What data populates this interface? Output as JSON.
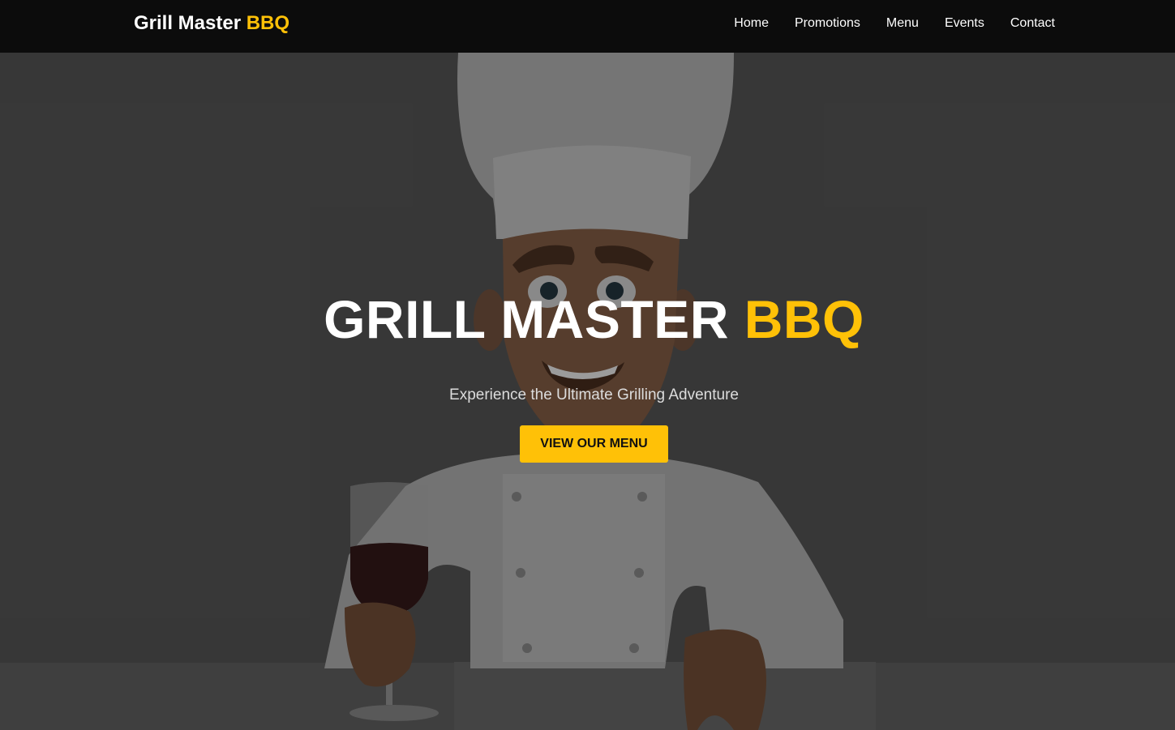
{
  "brand": {
    "name": "Grill Master",
    "accent": "BBQ"
  },
  "nav": {
    "items": [
      "Home",
      "Promotions",
      "Menu",
      "Events",
      "Contact"
    ]
  },
  "hero": {
    "title": "GRILL MASTER",
    "title_accent": "BBQ",
    "subtitle": "Experience the Ultimate Grilling Adventure",
    "cta_label": "VIEW OUR MENU"
  },
  "colors": {
    "accent": "#ffc107",
    "nav_bg": "#0c0c0c",
    "hero_bg": "#444444",
    "text": "#ffffff"
  },
  "icons": {
    "hero_image": "chef-cartoon-illustration"
  }
}
